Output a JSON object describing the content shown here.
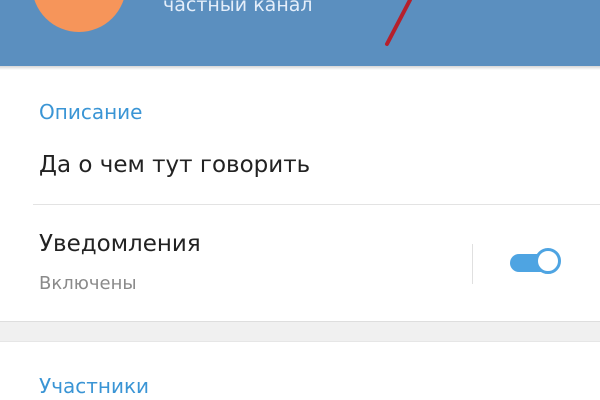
{
  "header": {
    "channel_status": "частный канал",
    "background_color": "#5b8fbf",
    "avatar_color": "#f6955a"
  },
  "description_section": {
    "title": "Описание",
    "text": "Да о чем тут говорить"
  },
  "notifications": {
    "label": "Уведомления",
    "status": "Включены",
    "enabled": true
  },
  "members_section": {
    "title": "Участники"
  },
  "colors": {
    "accent": "#3a95d5",
    "toggle_on": "#4ea4e2",
    "annotation_arrow": "#b5202c"
  }
}
